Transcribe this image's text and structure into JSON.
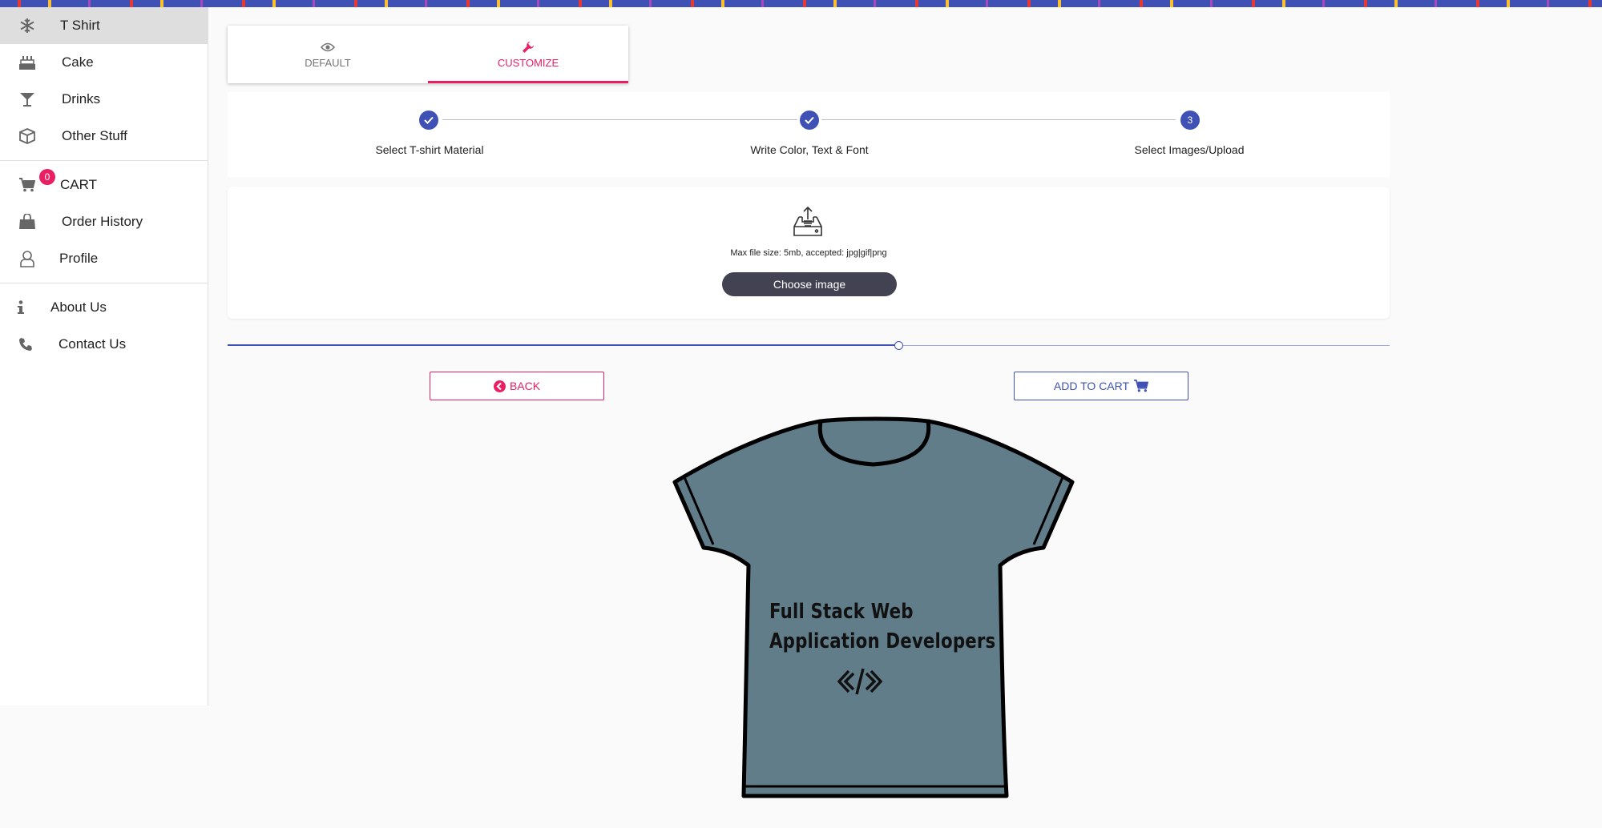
{
  "sidebar": {
    "items": [
      {
        "label": "T Shirt",
        "icon": "snowflake-icon"
      },
      {
        "label": "Cake",
        "icon": "cake-icon"
      },
      {
        "label": "Drinks",
        "icon": "cocktail-icon"
      },
      {
        "label": "Other Stuff",
        "icon": "cube-icon"
      }
    ],
    "cart": {
      "label": "CART",
      "badge": "0",
      "icon": "cart-icon"
    },
    "account": [
      {
        "label": "Order History",
        "icon": "shopping-bag-icon"
      },
      {
        "label": "Profile",
        "icon": "user-icon"
      }
    ],
    "info": [
      {
        "label": "About Us",
        "icon": "info-icon"
      },
      {
        "label": "Contact Us",
        "icon": "phone-icon"
      }
    ]
  },
  "tabs": [
    {
      "label": "DEFAULT",
      "icon": "eye-icon"
    },
    {
      "label": "CUSTOMIZE",
      "icon": "wrench-icon",
      "active": true
    }
  ],
  "stepper": {
    "steps": [
      {
        "label": "Select T-shirt Material",
        "state": "done"
      },
      {
        "label": "Write Color, Text & Font",
        "state": "done"
      },
      {
        "label": "Select Images/Upload",
        "state": "active",
        "number": "3"
      }
    ]
  },
  "upload": {
    "hint": "Max file size: 5mb, accepted: jpg|gif|png",
    "button": "Choose image"
  },
  "slider": {
    "value_percent": 57.7
  },
  "actions": {
    "back": "BACK",
    "add_to_cart": "ADD TO CART"
  },
  "preview": {
    "shirt_color": "#617d8a",
    "text_line1": "Full Stack Web",
    "text_line2": "Application Developers",
    "emblem": "</>"
  },
  "colors": {
    "primary": "#3f51b5",
    "accent": "#e91e63",
    "button_dark": "#424252"
  }
}
